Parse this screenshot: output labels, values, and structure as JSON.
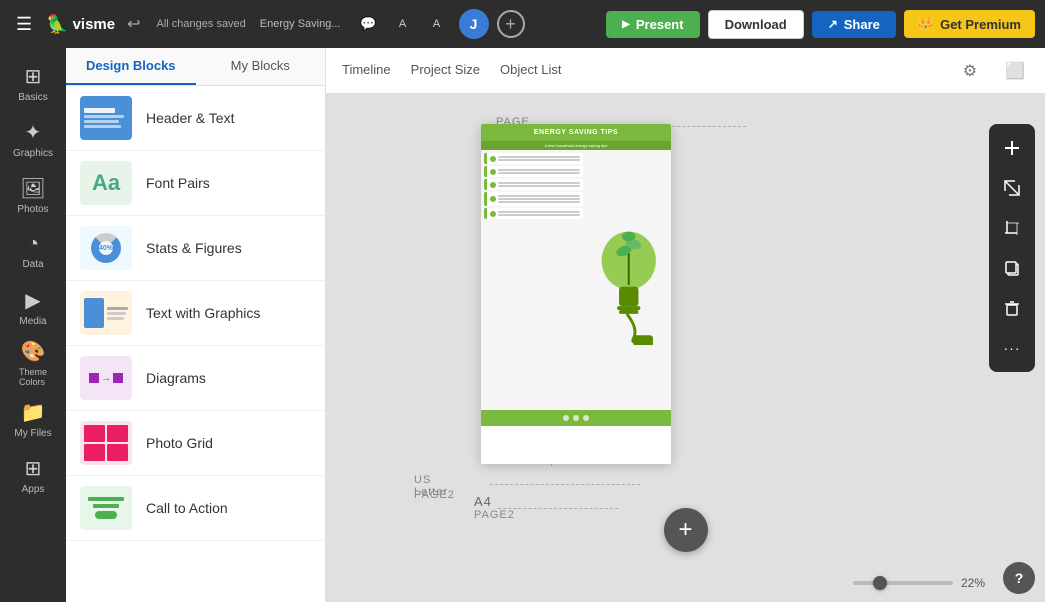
{
  "topbar": {
    "menu_icon": "☰",
    "logo_text": "visme",
    "undo_icon": "↩",
    "saved_text": "All changes saved",
    "project_title": "Energy Saving...",
    "comment_icon": "💬",
    "text_icon_a": "A",
    "text_icon_aa": "Aa",
    "avatar_letter": "J",
    "add_icon": "+",
    "present_label": "Present",
    "download_label": "Download",
    "share_label": "Share",
    "premium_label": "Get Premium"
  },
  "icon_sidebar": {
    "items": [
      {
        "id": "basics",
        "icon": "⊞",
        "label": "Basics"
      },
      {
        "id": "graphics",
        "icon": "✦",
        "label": "Graphics"
      },
      {
        "id": "photos",
        "icon": "🖼",
        "label": "Photos"
      },
      {
        "id": "data",
        "icon": "◔",
        "label": "Data"
      },
      {
        "id": "media",
        "icon": "▶",
        "label": "Media"
      },
      {
        "id": "theme-colors",
        "icon": "🎨",
        "label": "Theme Colors"
      },
      {
        "id": "my-files",
        "icon": "📁",
        "label": "My Files"
      },
      {
        "id": "apps",
        "icon": "⊞",
        "label": "Apps"
      }
    ]
  },
  "blocks_panel": {
    "tab_design": "Design Blocks",
    "tab_my": "My Blocks",
    "items": [
      {
        "id": "header-text",
        "label": "Header & Text"
      },
      {
        "id": "font-pairs",
        "label": "Font Pairs"
      },
      {
        "id": "stats-figures",
        "label": "Stats & Figures"
      },
      {
        "id": "text-graphics",
        "label": "Text with Graphics"
      },
      {
        "id": "diagrams",
        "label": "Diagrams"
      },
      {
        "id": "photo-grid",
        "label": "Photo Grid"
      },
      {
        "id": "call-to-action",
        "label": "Call to Action"
      }
    ]
  },
  "canvas_tabs": {
    "timeline": "Timeline",
    "project_size": "Project Size",
    "object_list": "Object List"
  },
  "canvas": {
    "page1_label": "PAGE 1",
    "us_letter_label": "US Letter",
    "page2_label": "PAGE2",
    "a4_label": "A4",
    "page2b_label": "PAGE2"
  },
  "right_toolbar": {
    "add_icon": "+",
    "resize_icon": "⤢",
    "crop_icon": "⊟",
    "copy_icon": "⧉",
    "delete_icon": "🗑",
    "more_icon": "···"
  },
  "zoom": {
    "value": "22%"
  },
  "help": {
    "label": "?"
  }
}
